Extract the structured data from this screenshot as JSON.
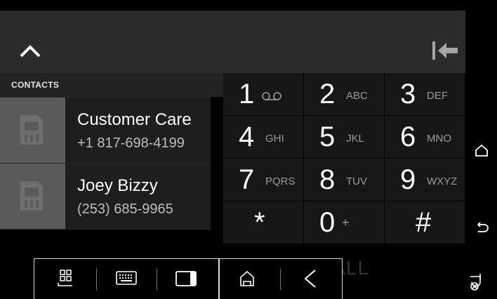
{
  "contacts_label": "CONTACTS",
  "contacts": [
    {
      "name": "Customer Care",
      "number": "+1 817-698-4199"
    },
    {
      "name": "Joey Bizzy",
      "number": "(253) 685-9965"
    }
  ],
  "dialpad": {
    "keys": [
      {
        "digit": "1",
        "letters": ""
      },
      {
        "digit": "2",
        "letters": "ABC"
      },
      {
        "digit": "3",
        "letters": "DEF"
      },
      {
        "digit": "4",
        "letters": "GHI"
      },
      {
        "digit": "5",
        "letters": "JKL"
      },
      {
        "digit": "6",
        "letters": "MNO"
      },
      {
        "digit": "7",
        "letters": "PQRS"
      },
      {
        "digit": "8",
        "letters": "TUV"
      },
      {
        "digit": "9",
        "letters": "WXYZ"
      },
      {
        "digit": "*",
        "letters": ""
      },
      {
        "digit": "0",
        "letters": "+"
      },
      {
        "digit": "#",
        "letters": ""
      }
    ]
  },
  "call_button_label": "CALL",
  "icons": {
    "collapse": "chevron-up-icon",
    "backspace": "backspace-icon",
    "voicemail": "voicemail-icon",
    "home": "home-icon",
    "back": "back-icon",
    "app_grid": "app-grid-icon",
    "keyboard": "keyboard-icon",
    "window": "window-icon",
    "car_home": "car-home-icon",
    "chevron_left": "chevron-left-icon",
    "notifications_off": "notification-off-icon"
  },
  "colors": {
    "header_bg": "#2b2b2b",
    "key_bg": "#171717",
    "avatar_bg": "#5a5a5a",
    "call_hint": "#1f3d35"
  }
}
